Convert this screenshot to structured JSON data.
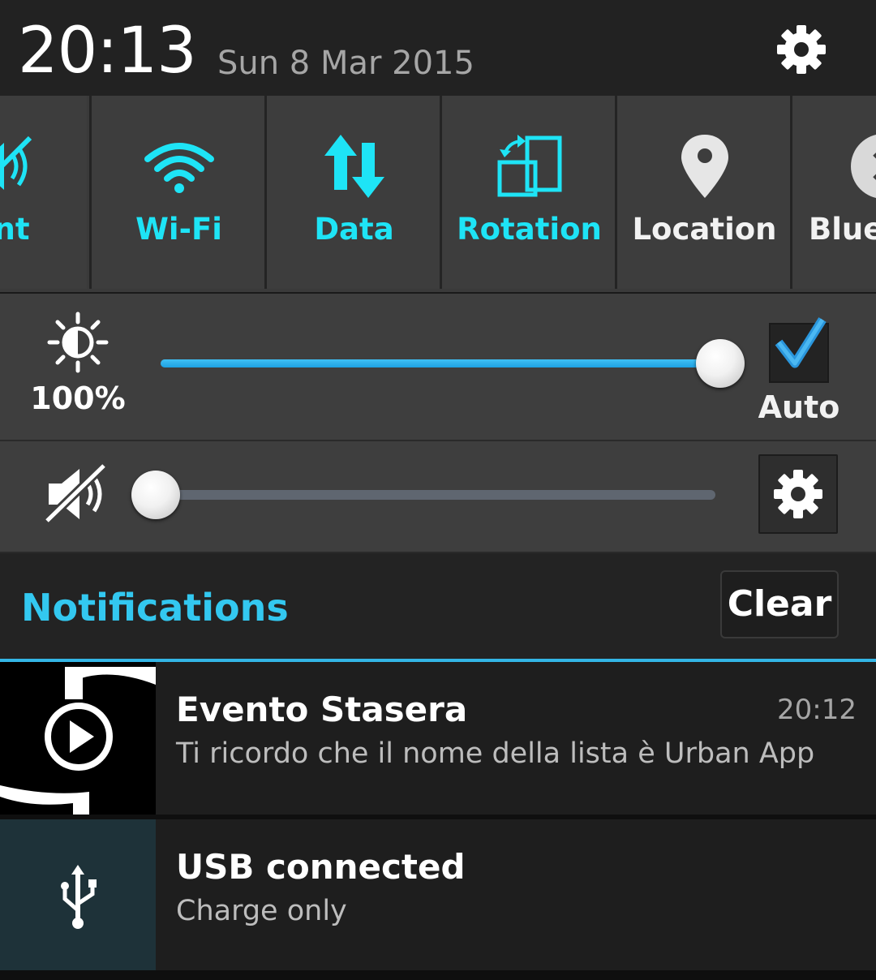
{
  "status": {
    "time": "20:13",
    "date": "Sun 8 Mar 2015",
    "settings_icon": "gear-icon"
  },
  "quick_settings": [
    {
      "label": "ent",
      "icon": "sound-icon",
      "state": "on"
    },
    {
      "label": "Wi-Fi",
      "icon": "wifi-icon",
      "state": "on"
    },
    {
      "label": "Data",
      "icon": "data-arrows-icon",
      "state": "on"
    },
    {
      "label": "Rotation",
      "icon": "rotation-icon",
      "state": "on"
    },
    {
      "label": "Location",
      "icon": "location-pin-icon",
      "state": "off"
    },
    {
      "label": "Bluet",
      "icon": "bluetooth-icon",
      "state": "off"
    }
  ],
  "brightness": {
    "percent_label": "100%",
    "level": 1.0,
    "auto_label": "Auto",
    "auto_checked": true
  },
  "volume": {
    "muted": true,
    "level": 0.0
  },
  "notifications": {
    "title": "Notifications",
    "clear_label": "Clear",
    "items": [
      {
        "title": "Evento Stasera",
        "text": "Ti ricordo che il nome della lista è Urban App",
        "time": "20:12",
        "icon": "play-app-icon"
      },
      {
        "title": "USB connected",
        "text": "Charge only",
        "time": "",
        "icon": "usb-icon"
      }
    ]
  },
  "colors": {
    "accent": "#1ee4f6",
    "notifications_accent": "#33c8f0",
    "slider_fill": "#1ea1e2"
  }
}
